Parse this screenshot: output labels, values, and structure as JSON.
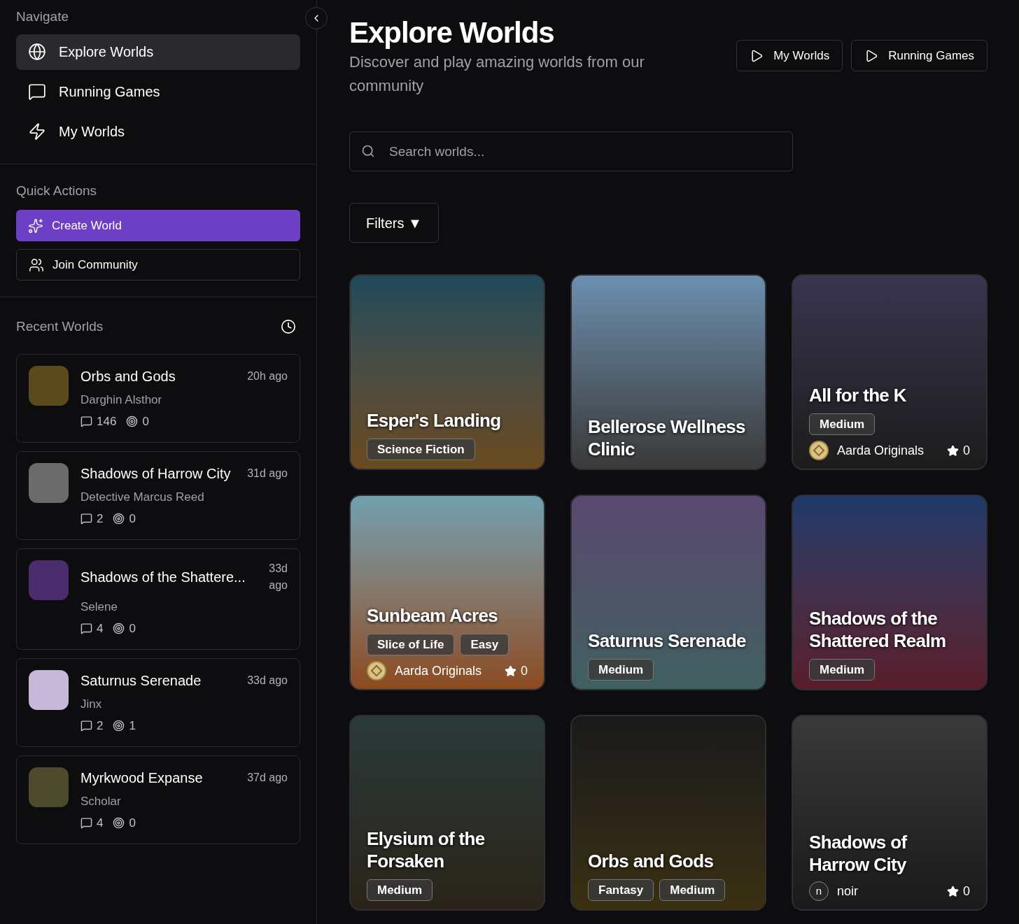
{
  "sidebar": {
    "navigate_heading": "Navigate",
    "nav_items": [
      {
        "label": "Explore Worlds",
        "selected": true
      },
      {
        "label": "Running Games",
        "selected": false
      },
      {
        "label": "My Worlds",
        "selected": false
      }
    ],
    "quick_actions_heading": "Quick Actions",
    "actions": [
      {
        "label": "Create World",
        "kind": "primary"
      },
      {
        "label": "Join Community",
        "kind": "outline"
      }
    ],
    "recent_heading": "Recent Worlds",
    "recent_worlds": [
      {
        "title": "Orbs and Gods",
        "author": "Darghin Alsthor",
        "time": "20h ago",
        "messages": "146",
        "plays": "0"
      },
      {
        "title": "Shadows of Harrow City",
        "author": "Detective Marcus Reed",
        "time": "31d ago",
        "messages": "2",
        "plays": "0"
      },
      {
        "title": "Shadows of the Shattere...",
        "author": "Selene",
        "time": "33d ago",
        "messages": "4",
        "plays": "0"
      },
      {
        "title": "Saturnus Serenade",
        "author": "Jinx",
        "time": "33d ago",
        "messages": "2",
        "plays": "1"
      },
      {
        "title": "Myrkwood Expanse",
        "author": "Scholar",
        "time": "37d ago",
        "messages": "4",
        "plays": "0"
      }
    ]
  },
  "header": {
    "title": "Explore Worlds",
    "subtitle": "Discover and play amazing worlds from our community",
    "buttons": [
      "My Worlds",
      "Running Games"
    ]
  },
  "search": {
    "placeholder": "Search worlds..."
  },
  "filters_button": "Filters ▼",
  "worlds": [
    {
      "title": "Esper's Landing",
      "tags": [
        "Science Fiction"
      ]
    },
    {
      "title": "Bellerose Wellness Clinic"
    },
    {
      "title": "All for the K",
      "tags": [
        "Medium"
      ],
      "author": {
        "name": "Aarda Originals",
        "kind": "logo"
      },
      "stars_count": "0"
    },
    {
      "title": "Sunbeam Acres",
      "tags": [
        "Slice of Life",
        "Easy"
      ],
      "author": {
        "name": "Aarda Originals",
        "kind": "logo"
      },
      "stars_count": "0"
    },
    {
      "title": "Saturnus Serenade",
      "tags": [
        "Medium"
      ]
    },
    {
      "title": "Shadows of the Shattered Realm",
      "tags": [
        "Medium"
      ]
    },
    {
      "title": "Elysium of the Forsaken",
      "tags": [
        "Medium"
      ]
    },
    {
      "title": "Orbs and Gods",
      "tags": [
        "Fantasy",
        "Medium"
      ]
    },
    {
      "title": "Shadows of Harrow City",
      "author": {
        "name": "noir",
        "kind": "initial",
        "initial": "n"
      },
      "stars_count": "0"
    }
  ]
}
